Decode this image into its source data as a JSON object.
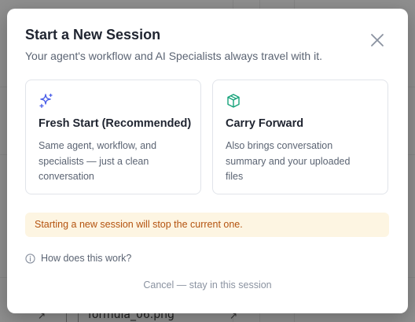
{
  "background": {
    "file_name": "formula_06.png"
  },
  "modal": {
    "title": "Start a New Session",
    "subtitle": "Your agent's workflow and AI Specialists always travel with it.",
    "close_icon": "close-icon",
    "options": [
      {
        "icon": "sparkles-icon",
        "icon_color": "#4a5ee8",
        "title": "Fresh Start (Recommended)",
        "description": "Same agent, workflow, and specialists — just a clean conversation"
      },
      {
        "icon": "package-icon",
        "icon_color": "#16a37a",
        "title": "Carry Forward",
        "description": "Also brings conversation summary and your uploaded files"
      }
    ],
    "warning": "Starting a new session will stop the current one.",
    "help_link": "How does this work?",
    "cancel_link": "Cancel — stay in this session"
  },
  "colors": {
    "warning_bg": "#fdf5e2",
    "warning_text": "#b4530f"
  }
}
